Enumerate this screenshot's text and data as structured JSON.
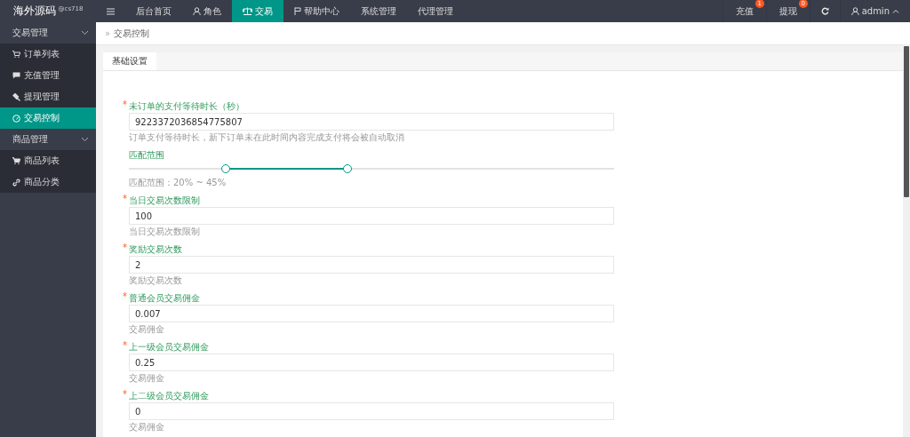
{
  "logo": {
    "title": "海外源码",
    "tag": "@cs718"
  },
  "nav": [
    {
      "label": "后台首页",
      "selected": false
    },
    {
      "label": "角色",
      "selected": false
    },
    {
      "label": "交易",
      "selected": true
    },
    {
      "label": "帮助中心",
      "selected": false
    },
    {
      "label": "系统管理",
      "selected": false
    },
    {
      "label": "代理管理",
      "selected": false
    }
  ],
  "notices": [
    {
      "label": "充值",
      "badge": "1"
    },
    {
      "label": "提现",
      "badge": "0"
    }
  ],
  "user": {
    "name": "admin"
  },
  "sidebar": [
    {
      "label": "交易管理",
      "expanded": true,
      "children": [
        {
          "label": "订单列表",
          "selected": false
        },
        {
          "label": "充值管理",
          "selected": false
        },
        {
          "label": "提现管理",
          "selected": false
        },
        {
          "label": "交易控制",
          "selected": true
        }
      ]
    },
    {
      "label": "商品管理",
      "expanded": true,
      "children": [
        {
          "label": "商品列表",
          "selected": false
        },
        {
          "label": "商品分类",
          "selected": false
        }
      ]
    }
  ],
  "breadcrumb": {
    "separator": "»",
    "current": "交易控制"
  },
  "tabs": [
    {
      "label": "基础设置",
      "selected": true
    }
  ],
  "fields": [
    {
      "kind": "input",
      "required_mark": "*",
      "label": "未订单的支付等待时长（秒）",
      "value": "9223372036854775807",
      "help": "订单支付等待时长，新下订单未在此时间内容完成支付将会被自动取消"
    },
    {
      "kind": "range",
      "label": "匹配范围",
      "thumbs": [
        {
          "level": 0.2
        },
        {
          "level": 0.45
        }
      ],
      "help": "匹配范围：20% ~ 45%"
    },
    {
      "kind": "input",
      "required_mark": "*",
      "label": "当日交易次数限制",
      "value": "100",
      "help": "当日交易次数限制"
    },
    {
      "kind": "input",
      "required_mark": "*",
      "label": "奖励交易次数",
      "value": "2",
      "help": "奖励交易次数"
    },
    {
      "kind": "input",
      "required_mark": "*",
      "label": "普通会员交易佣金",
      "value": "0.007",
      "help": "交易佣金"
    },
    {
      "kind": "input",
      "required_mark": "*",
      "label": "上一级会员交易佣金",
      "value": "0.25",
      "help": "交易佣金"
    },
    {
      "kind": "input",
      "required_mark": "*",
      "label": "上二级会员交易佣金",
      "value": "0",
      "help": "交易佣金"
    }
  ]
}
